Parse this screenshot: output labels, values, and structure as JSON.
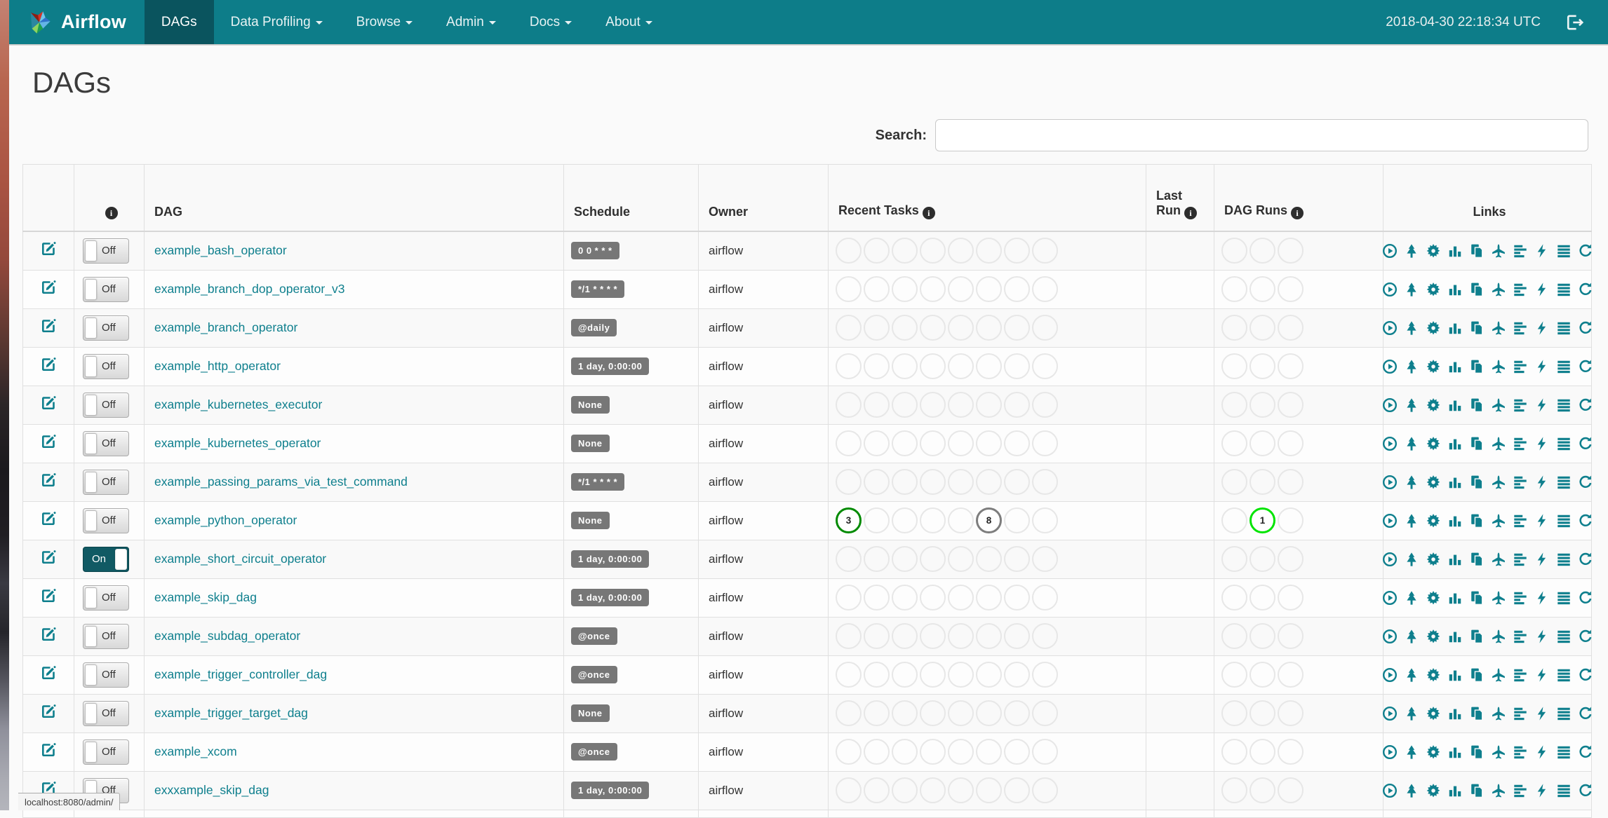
{
  "navbar": {
    "brand": "Airflow",
    "items": [
      {
        "label": "DAGs",
        "active": true,
        "dropdown": false
      },
      {
        "label": "Data Profiling",
        "active": false,
        "dropdown": true
      },
      {
        "label": "Browse",
        "active": false,
        "dropdown": true
      },
      {
        "label": "Admin",
        "active": false,
        "dropdown": true
      },
      {
        "label": "Docs",
        "active": false,
        "dropdown": true
      },
      {
        "label": "About",
        "active": false,
        "dropdown": true
      }
    ],
    "clock": "2018-04-30 22:18:34 UTC"
  },
  "page": {
    "title": "DAGs",
    "search_label": "Search:",
    "search_value": "",
    "status_bar": "localhost:8080/admin/"
  },
  "icons": {
    "info_glyph": "i"
  },
  "colors": {
    "navbar": "#0d7d89",
    "navbar_active": "#0a545e",
    "accent_teal": "#0e7f8d",
    "badge_bg": "#777777",
    "task_success": "#008a00",
    "task_queued": "#7d7d7d",
    "run_running": "#00e400",
    "empty_circle": "#e7e7e7"
  },
  "table": {
    "headers": {
      "edit": "",
      "info": "",
      "dag": "DAG",
      "schedule": "Schedule",
      "owner": "Owner",
      "recent_tasks": "Recent Tasks",
      "last_run": "Last Run",
      "dag_runs": "DAG Runs",
      "links": "Links"
    },
    "recent_task_slots": 8,
    "dag_run_slots": 3,
    "link_icons": [
      {
        "name": "play-circle",
        "title": "Trigger Dag"
      },
      {
        "name": "tree",
        "title": "Tree View"
      },
      {
        "name": "burst",
        "title": "Graph View"
      },
      {
        "name": "bar-chart",
        "title": "Task Duration"
      },
      {
        "name": "duplicate",
        "title": "Task Tries"
      },
      {
        "name": "plane",
        "title": "Landing Times"
      },
      {
        "name": "align-left",
        "title": "Gantt View"
      },
      {
        "name": "flash",
        "title": "Code View"
      },
      {
        "name": "align-justify",
        "title": "Logs"
      },
      {
        "name": "refresh",
        "title": "Refresh"
      }
    ],
    "rows": [
      {
        "dag_id": "example_bash_operator",
        "toggle": "Off",
        "schedule": "0 0 * * *",
        "owner": "airflow",
        "last_run": "",
        "recent_tasks": [],
        "dag_runs": []
      },
      {
        "dag_id": "example_branch_dop_operator_v3",
        "toggle": "Off",
        "schedule": "*/1 * * * *",
        "owner": "airflow",
        "last_run": "",
        "recent_tasks": [],
        "dag_runs": []
      },
      {
        "dag_id": "example_branch_operator",
        "toggle": "Off",
        "schedule": "@daily",
        "owner": "airflow",
        "last_run": "",
        "recent_tasks": [],
        "dag_runs": []
      },
      {
        "dag_id": "example_http_operator",
        "toggle": "Off",
        "schedule": "1 day, 0:00:00",
        "owner": "airflow",
        "last_run": "",
        "recent_tasks": [],
        "dag_runs": []
      },
      {
        "dag_id": "example_kubernetes_executor",
        "toggle": "Off",
        "schedule": "None",
        "owner": "airflow",
        "last_run": "",
        "recent_tasks": [],
        "dag_runs": []
      },
      {
        "dag_id": "example_kubernetes_operator",
        "toggle": "Off",
        "schedule": "None",
        "owner": "airflow",
        "last_run": "",
        "recent_tasks": [],
        "dag_runs": []
      },
      {
        "dag_id": "example_passing_params_via_test_command",
        "toggle": "Off",
        "schedule": "*/1 * * * *",
        "owner": "airflow",
        "last_run": "",
        "recent_tasks": [],
        "dag_runs": []
      },
      {
        "dag_id": "example_python_operator",
        "toggle": "Off",
        "schedule": "None",
        "owner": "airflow",
        "last_run": "",
        "recent_tasks": [
          {
            "slot": 0,
            "value": "3",
            "color": "#008a00"
          },
          {
            "slot": 5,
            "value": "8",
            "color": "#7d7d7d"
          }
        ],
        "dag_runs": [
          {
            "slot": 1,
            "value": "1",
            "color": "#00e400"
          }
        ]
      },
      {
        "dag_id": "example_short_circuit_operator",
        "toggle": "On",
        "schedule": "1 day, 0:00:00",
        "owner": "airflow",
        "last_run": "",
        "recent_tasks": [],
        "dag_runs": []
      },
      {
        "dag_id": "example_skip_dag",
        "toggle": "Off",
        "schedule": "1 day, 0:00:00",
        "owner": "airflow",
        "last_run": "",
        "recent_tasks": [],
        "dag_runs": []
      },
      {
        "dag_id": "example_subdag_operator",
        "toggle": "Off",
        "schedule": "@once",
        "owner": "airflow",
        "last_run": "",
        "recent_tasks": [],
        "dag_runs": []
      },
      {
        "dag_id": "example_trigger_controller_dag",
        "toggle": "Off",
        "schedule": "@once",
        "owner": "airflow",
        "last_run": "",
        "recent_tasks": [],
        "dag_runs": []
      },
      {
        "dag_id": "example_trigger_target_dag",
        "toggle": "Off",
        "schedule": "None",
        "owner": "airflow",
        "last_run": "",
        "recent_tasks": [],
        "dag_runs": []
      },
      {
        "dag_id": "example_xcom",
        "toggle": "Off",
        "schedule": "@once",
        "owner": "airflow",
        "last_run": "",
        "recent_tasks": [],
        "dag_runs": []
      },
      {
        "dag_id": "exxxample_skip_dag",
        "toggle": "Off",
        "schedule": "1 day, 0:00:00",
        "owner": "airflow",
        "last_run": "",
        "recent_tasks": [],
        "dag_runs": []
      }
    ],
    "partial_row_visible": true
  }
}
